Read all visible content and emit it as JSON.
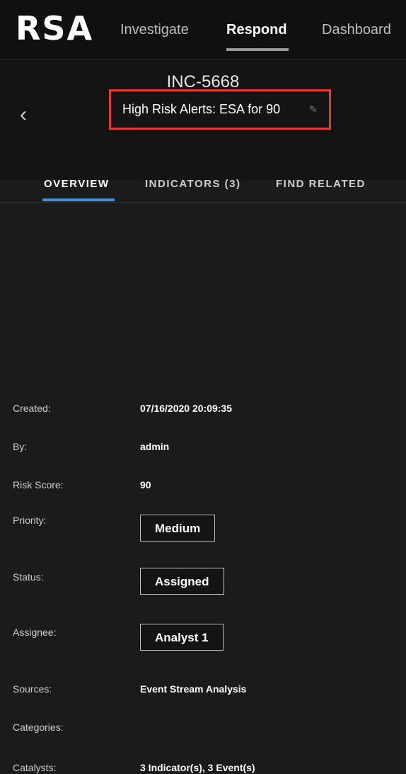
{
  "nav": {
    "logo": "RSA",
    "items": [
      "Investigate",
      "Respond",
      "Dashboard"
    ],
    "active_index": 1
  },
  "incident": {
    "id": "INC-5668",
    "title": "High Risk Alerts: ESA for 90",
    "back_icon": "chevron-left-icon",
    "edit_icon": "pencil-icon",
    "highlight_color": "#e53935"
  },
  "tabs": [
    {
      "label": "OVERVIEW",
      "active": true
    },
    {
      "label": "INDICATORS (3)",
      "active": false
    },
    {
      "label": "FIND RELATED",
      "active": false
    }
  ],
  "details": {
    "created_label": "Created:",
    "created_value": "07/16/2020 20:09:35",
    "by_label": "By:",
    "by_value": "admin",
    "risk_label": "Risk Score:",
    "risk_value": "90",
    "priority_label": "Priority:",
    "priority_value": "Medium",
    "status_label": "Status:",
    "status_value": "Assigned",
    "assignee_label": "Assignee:",
    "assignee_value": "Analyst 1",
    "sources_label": "Sources:",
    "sources_value": "Event Stream Analysis",
    "categories_label": "Categories:",
    "categories_value": "",
    "catalysts_label": "Catalysts:",
    "catalysts_value": "3 Indicator(s), 3 Event(s)"
  }
}
